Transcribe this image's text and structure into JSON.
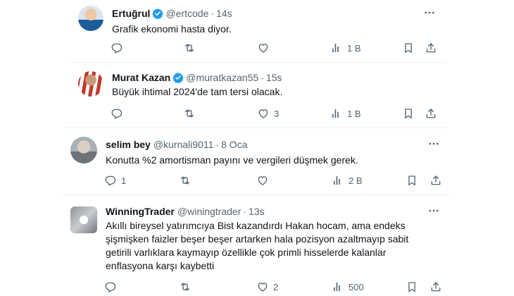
{
  "tweets": [
    {
      "name": "Ertuğrul",
      "verified": true,
      "handle": "@ertcode",
      "time": "14s",
      "text": "Grafik ekonomi hasta diyor.",
      "replies": "",
      "likes": "",
      "views": "1 B"
    },
    {
      "name": "Murat Kazan",
      "verified": true,
      "handle": "@muratkazan55",
      "time": "15s",
      "text": "Büyük ihtimal 2024'de tam tersi olacak.",
      "replies": "",
      "likes": "3",
      "views": "1 B"
    },
    {
      "name": "selim bey",
      "verified": false,
      "handle": "@kurnali9011",
      "time": "8 Oca",
      "text": "Konutta %2 amortisman payını ve vergileri düşmek gerek.",
      "replies": "1",
      "likes": "",
      "views": "2 B"
    },
    {
      "name": "WinningTrader",
      "verified": false,
      "handle": "@winingtrader",
      "time": "13s",
      "text_lines": [
        "Akıllı bireysel yatırımcıya Bist kazandırdı Hakan hocam, ama endeks",
        "şişmişken faizler beşer beşer artarken hala pozisyon azaltmayıp sabit",
        "getirili varlıklara kaymayıp özellikle çok primli hisselerde kalanlar",
        "enflasyona karşı kaybetti"
      ],
      "replies": "",
      "likes": "2",
      "views": "500"
    }
  ],
  "icons": {
    "reply": "reply-icon",
    "retweet": "retweet-icon",
    "like": "like-icon",
    "views": "views-icon",
    "bookmark": "bookmark-icon",
    "share": "share-icon",
    "more": "more-icon",
    "verified": "verified-badge-icon"
  },
  "colors": {
    "text": "#0f1419",
    "secondary": "#536471",
    "verified": "#1d9bf0",
    "divider": "#eff3f4"
  }
}
